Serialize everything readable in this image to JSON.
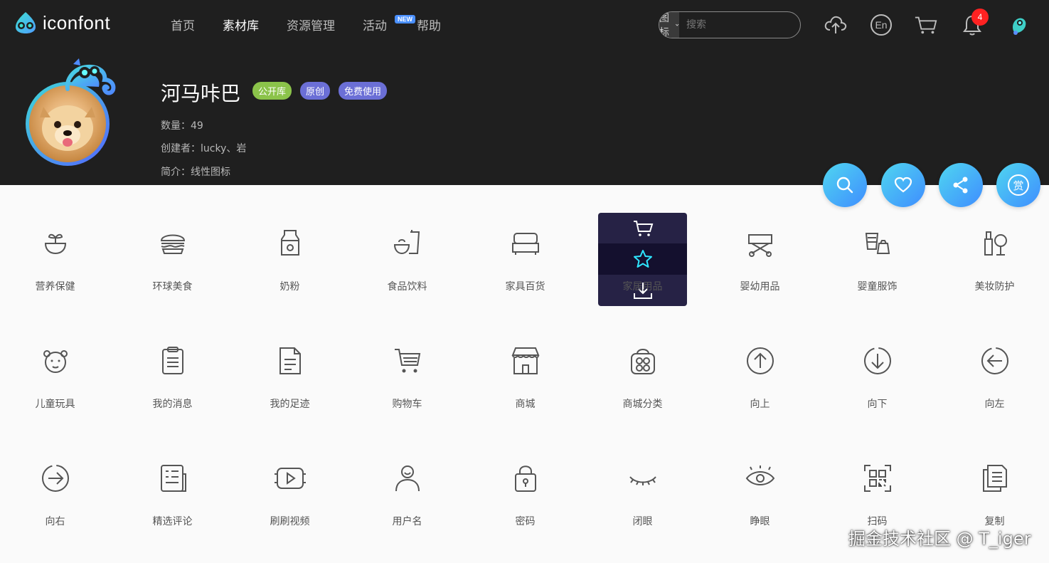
{
  "brand": {
    "name": "iconfont"
  },
  "nav": [
    {
      "label": "首页",
      "active": false
    },
    {
      "label": "素材库",
      "active": true
    },
    {
      "label": "资源管理",
      "active": false
    },
    {
      "label": "活动",
      "active": false,
      "badge": "NEW"
    },
    {
      "label": "帮助",
      "active": false
    }
  ],
  "search": {
    "type": "图标",
    "placeholder": "搜索"
  },
  "topbar_icons": [
    "upload-icon",
    "language-en-icon",
    "cart-icon",
    "bell-icon",
    "user-avatar"
  ],
  "notifications": {
    "count": "4"
  },
  "language": {
    "label": "En"
  },
  "library": {
    "title": "河马咔巴",
    "tags": [
      {
        "label": "公开库",
        "color": "#8bc34a"
      },
      {
        "label": "原创",
        "color": "#6b6fd6"
      },
      {
        "label": "免费使用",
        "color": "#6b6fd6"
      }
    ],
    "count_label": "数量：49",
    "creator_label": "创建者：lucky、岩",
    "desc_label": "简介：线性图标"
  },
  "actions": [
    {
      "name": "search-icon"
    },
    {
      "name": "heart-icon"
    },
    {
      "name": "share-icon"
    },
    {
      "name": "reward-icon",
      "label": "赏"
    }
  ],
  "icons": [
    {
      "label": "营养保健",
      "icon": "nutrition-bowl-icon"
    },
    {
      "label": "环球美食",
      "icon": "burger-icon"
    },
    {
      "label": "奶粉",
      "icon": "milk-powder-icon"
    },
    {
      "label": "食品饮料",
      "icon": "food-drink-icon"
    },
    {
      "label": "家具百货",
      "icon": "sofa-icon"
    },
    {
      "label": "家居用品",
      "icon": "home-goods-icon"
    },
    {
      "label": "婴幼用品",
      "icon": "stroller-icon"
    },
    {
      "label": "婴童服饰",
      "icon": "baby-clothing-icon"
    },
    {
      "label": "美妆防护",
      "icon": "cosmetics-icon"
    },
    {
      "label": "儿童玩具",
      "icon": "toy-icon"
    },
    {
      "label": "我的消息",
      "icon": "clipboard-icon"
    },
    {
      "label": "我的足迹",
      "icon": "document-icon"
    },
    {
      "label": "购物车",
      "icon": "shopping-cart-icon"
    },
    {
      "label": "商城",
      "icon": "store-icon"
    },
    {
      "label": "商城分类",
      "icon": "category-bag-icon"
    },
    {
      "label": "向上",
      "icon": "arrow-up-circle-icon"
    },
    {
      "label": "向下",
      "icon": "arrow-down-circle-icon"
    },
    {
      "label": "向左",
      "icon": "arrow-left-circle-icon"
    },
    {
      "label": "向右",
      "icon": "arrow-right-circle-icon"
    },
    {
      "label": "精选评论",
      "icon": "comment-list-icon"
    },
    {
      "label": "刷刷视频",
      "icon": "video-play-icon"
    },
    {
      "label": "用户名",
      "icon": "user-icon"
    },
    {
      "label": "密码",
      "icon": "lock-icon"
    },
    {
      "label": "闭眼",
      "icon": "eye-closed-icon"
    },
    {
      "label": "睁眼",
      "icon": "eye-open-icon"
    },
    {
      "label": "扫码",
      "icon": "scan-qr-icon"
    },
    {
      "label": "复制",
      "icon": "copy-icon"
    }
  ],
  "hover_card": {
    "actions": [
      "add-to-cart-icon",
      "favorite-star-icon",
      "download-icon"
    ]
  },
  "watermark": "掘金技术社区 @ T_iger",
  "colors": {
    "header_bg": "#1f1f1f",
    "accent": "#3f8dff",
    "accent2": "#4fd6f0",
    "star": "#2ee6ff",
    "badge_red": "#ff2222"
  }
}
